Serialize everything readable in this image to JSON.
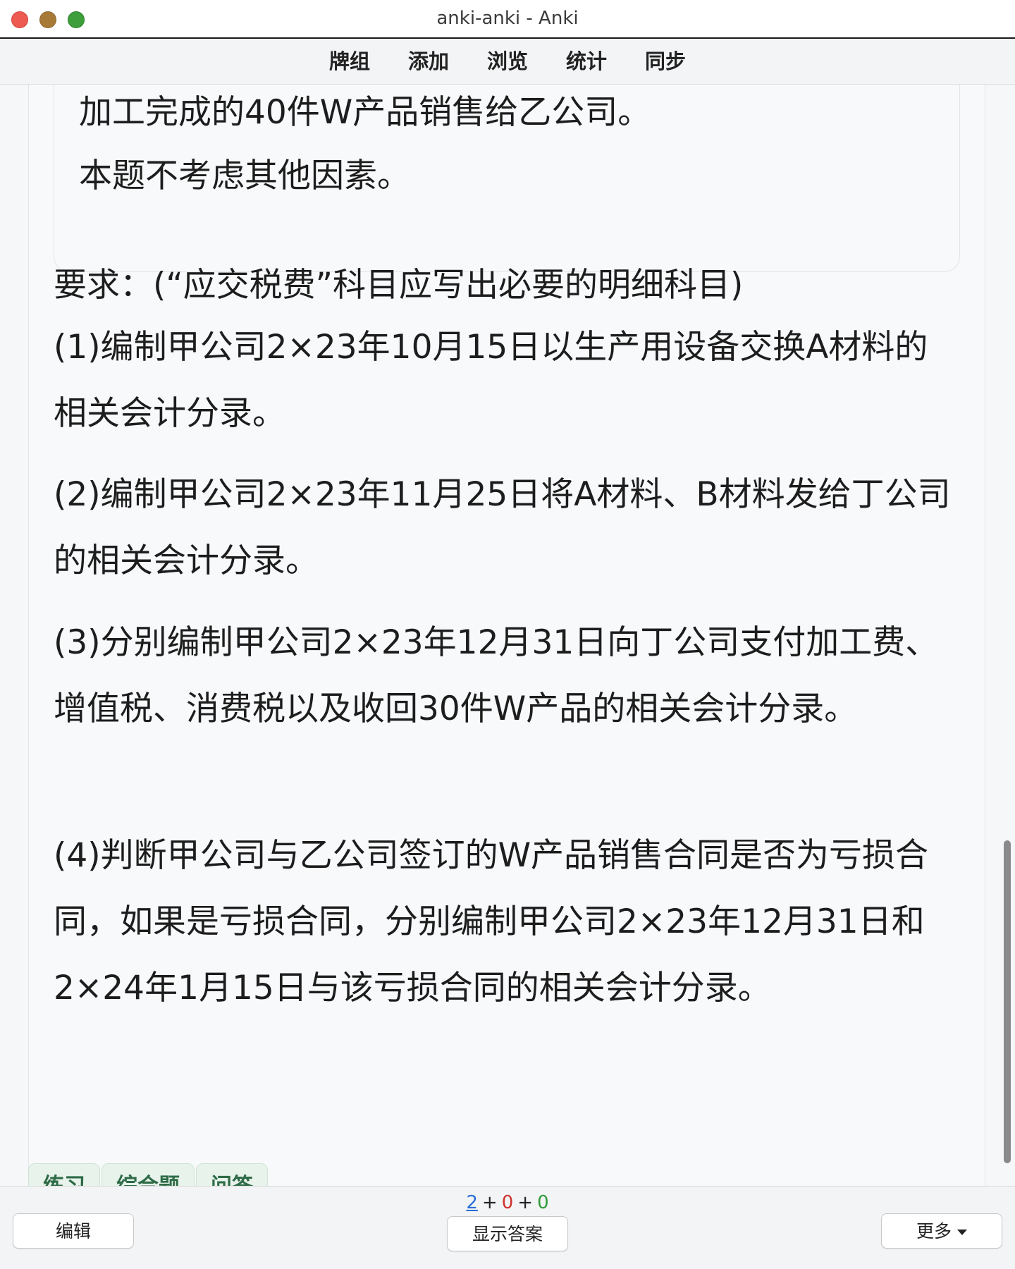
{
  "window": {
    "title": "anki-anki - Anki"
  },
  "toolbar": {
    "items": [
      "牌组",
      "添加",
      "浏览",
      "统计",
      "同步"
    ]
  },
  "card": {
    "inner_lines": [
      "加工完成的40件W产品销售给乙公司。",
      "本题不考虑其他因素。"
    ],
    "requirement": "要求：(“应交税费”科目应写出必要的明细科目)",
    "questions": [
      "(1)编制甲公司2×23年10月15日以生产用设备交换A材料的相关会计分录。",
      "(2)编制甲公司2×23年11月25日将A材料、B材料发给丁公司的相关会计分录。",
      "(3)分别编制甲公司2×23年12月31日向丁公司支付加工费、增值税、消费税以及收回30件W产品的相关会计分录。",
      "(4)判断甲公司与乙公司签订的W产品销售合同是否为亏损合同，如果是亏损合同，分别编制甲公司2×23年12月31日和2×24年1月15日与该亏损合同的相关会计分录。"
    ],
    "tags": [
      "练习",
      "综合题",
      "问答"
    ]
  },
  "bottom": {
    "edit_label": "编辑",
    "show_answer_label": "显示答案",
    "more_label": "更多",
    "counts": {
      "new": "2",
      "learning": "0",
      "review": "0",
      "plus": "+"
    }
  },
  "colors": {
    "new": "#2a6fd6",
    "learning": "#d0312d",
    "review": "#2f9a3a",
    "close": "#ec5a52",
    "minimize": "#a87a38",
    "zoom": "#3f9e3c"
  }
}
